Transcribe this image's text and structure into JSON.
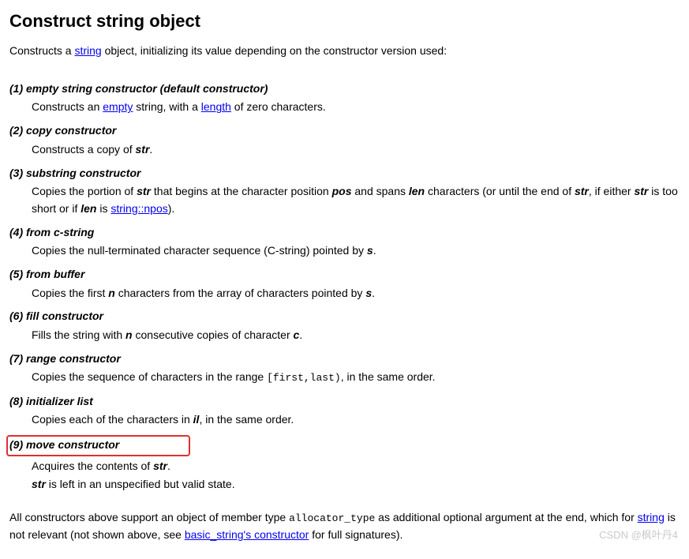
{
  "title": "Construct string object",
  "intro": {
    "prefix": "Constructs a ",
    "link_string": "string",
    "suffix": " object, initializing its value depending on the constructor version used:"
  },
  "items": [
    {
      "heading": "(1) empty string constructor (default constructor)",
      "desc_html": "Constructs an <a href='#' data-name='link-empty' data-interactable='true'>empty</a> string, with a <a href='#' data-name='link-length' data-interactable='true'>length</a> of zero characters."
    },
    {
      "heading": "(2) copy constructor",
      "desc_html": "Constructs a copy of <span class='bi'>str</span>."
    },
    {
      "heading": "(3) substring constructor",
      "desc_html": "Copies the portion of <span class='bi'>str</span> that begins at the character position <span class='bi'>pos</span> and spans <span class='bi'>len</span> characters (or until the end of <span class='bi'>str</span>, if either <span class='bi'>str</span> is too short or if <span class='bi'>len</span> is <a href='#' data-name='link-npos' data-interactable='true'>string::npos</a>)."
    },
    {
      "heading": "(4) from c-string",
      "desc_html": "Copies the null-terminated character sequence (C-string) pointed by <span class='bi'>s</span>."
    },
    {
      "heading": "(5) from buffer",
      "desc_html": "Copies the first <span class='bi'>n</span> characters from the array of characters pointed by <span class='bi'>s</span>."
    },
    {
      "heading": "(6) fill constructor",
      "desc_html": "Fills the string with <span class='bi'>n</span> consecutive copies of character <span class='bi'>c</span>."
    },
    {
      "heading": "(7) range constructor",
      "desc_html": "Copies the sequence of characters in the range <span class='mono'>[first,last)</span>, in the same order."
    },
    {
      "heading": "(8) initializer list",
      "desc_html": "Copies each of the characters in <span class='bi'>il</span>, in the same order."
    },
    {
      "heading": "(9) move constructor",
      "highlighted": true,
      "desc_html": "<p>Acquires the contents of <span class='bi'>str</span>.</p><p><span class='bi'>str</span> is left in an unspecified but valid state.</p>"
    }
  ],
  "footnote": {
    "prefix": "All constructors above support an object of member type ",
    "code": "allocator_type",
    "mid1": " as additional optional argument at the end, which for ",
    "link_string": "string",
    "mid2": " is not relevant (not shown above, see ",
    "link_basic": "basic_string's constructor",
    "suffix": " for full signatures)."
  },
  "watermark": "CSDN @枫叶丹4"
}
